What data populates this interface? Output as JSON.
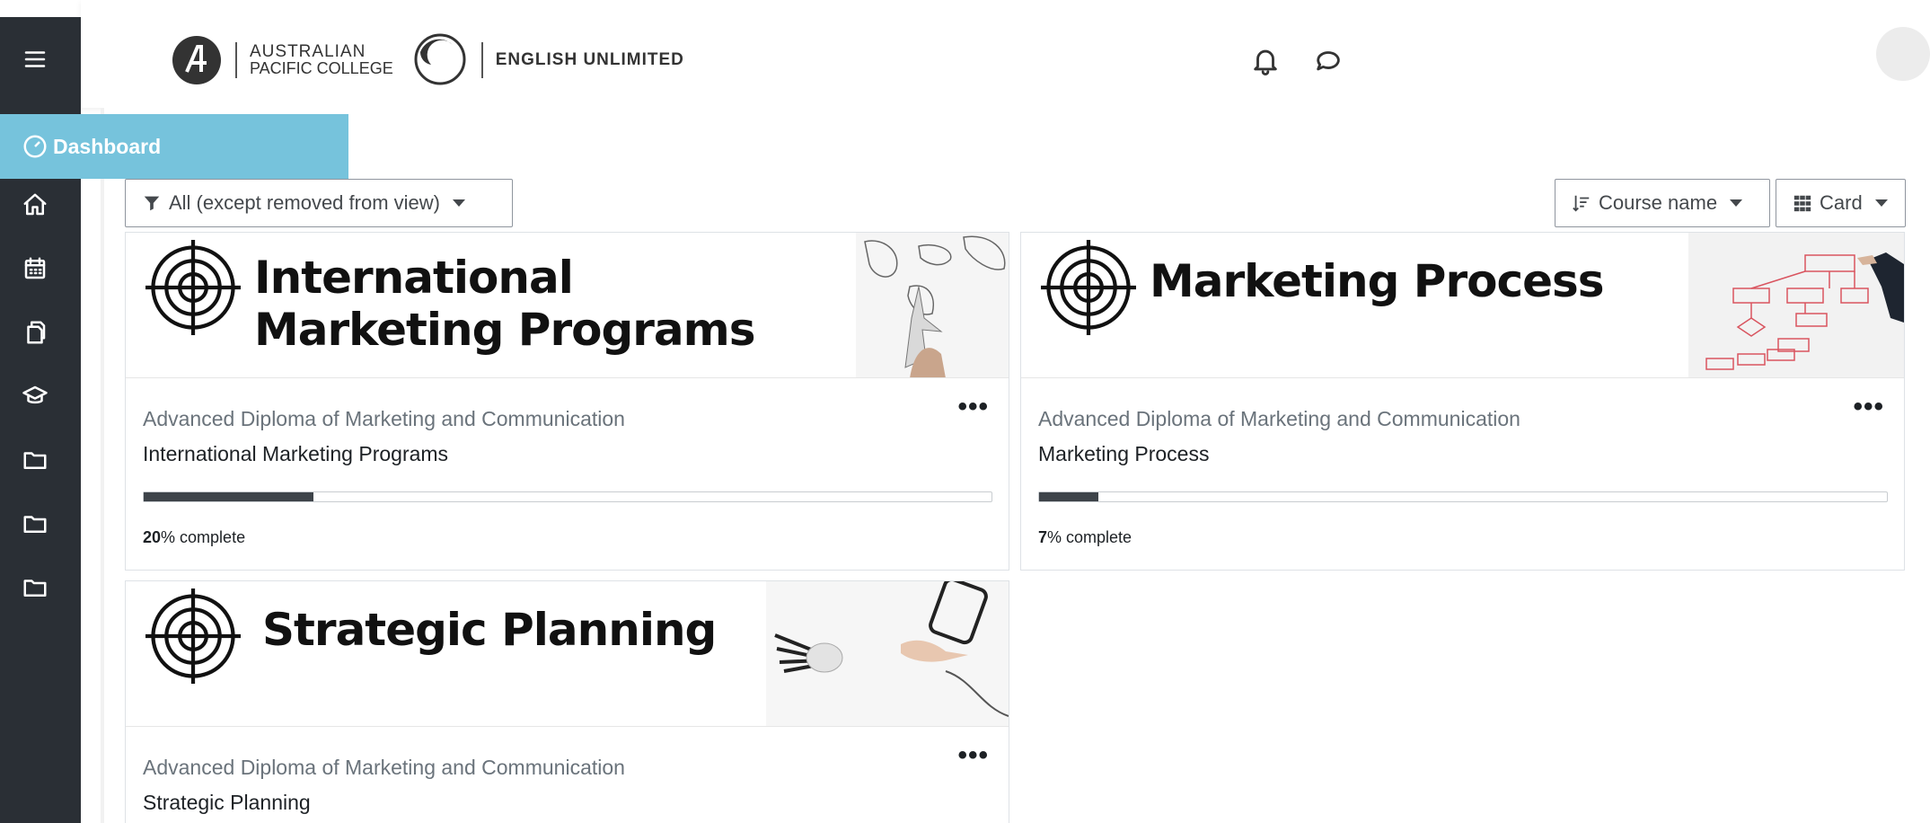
{
  "header": {
    "logo_line1": "AUSTRALIAN",
    "logo_line2": "PACIFIC COLLEGE",
    "logo_brand2": "ENGLISH UNLIMITED"
  },
  "nav": {
    "dashboard_label": "Dashboard",
    "icons": [
      "menu-icon",
      "home-icon",
      "calendar-icon",
      "files-icon",
      "graduation-cap-icon",
      "folder-icon",
      "folder-icon",
      "folder-icon"
    ]
  },
  "filters": {
    "grouping_label": "All (except removed from view)",
    "sort_label": "Course name",
    "view_label": "Card"
  },
  "courses": [
    {
      "image_title_line1": "International",
      "image_title_line2": "Marketing Programs",
      "category": "Advanced Diploma of Marketing and Communication",
      "name": "International Marketing Programs",
      "progress_percent": 20,
      "progress_num": "20",
      "progress_suffix": "% complete"
    },
    {
      "image_title_line1": "Marketing Process",
      "category": "Advanced Diploma of Marketing and Communication",
      "name": "Marketing Process",
      "progress_percent": 7,
      "progress_num": "7",
      "progress_suffix": "% complete"
    },
    {
      "image_title_line1": "Strategic Planning",
      "category": "Advanced Diploma of Marketing and Communication",
      "name": "Strategic Planning"
    }
  ],
  "colors": {
    "sidebar": "#2a2f35",
    "dashboard_tab": "#76c3dc",
    "progress_fill": "#3e444a"
  }
}
